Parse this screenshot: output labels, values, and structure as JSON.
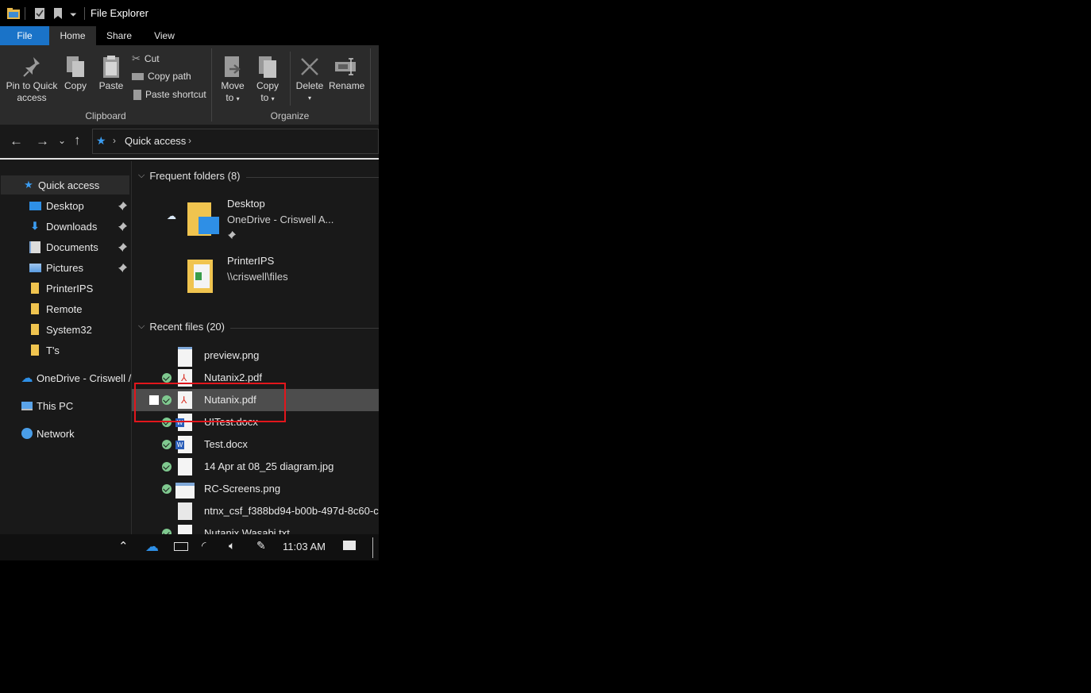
{
  "window": {
    "title": "File Explorer"
  },
  "tabs": {
    "file": "File",
    "home": "Home",
    "share": "Share",
    "view": "View"
  },
  "ribbon": {
    "pin_quick_access": [
      "Pin to Quick",
      "access"
    ],
    "copy": "Copy",
    "paste": "Paste",
    "cut": "Cut",
    "copy_path": "Copy path",
    "paste_shortcut": "Paste shortcut",
    "clipboard_group": "Clipboard",
    "move_to": [
      "Move",
      "to"
    ],
    "copy_to": [
      "Copy",
      "to"
    ],
    "delete": "Delete",
    "rename": "Rename",
    "organize_group": "Organize"
  },
  "address": {
    "crumb": "Quick access"
  },
  "sidebar": {
    "quick_access": "Quick access",
    "items": [
      {
        "label": "Desktop",
        "pinned": true
      },
      {
        "label": "Downloads",
        "pinned": true
      },
      {
        "label": "Documents",
        "pinned": true
      },
      {
        "label": "Pictures",
        "pinned": true
      },
      {
        "label": "PrinterIPS",
        "pinned": false
      },
      {
        "label": "Remote",
        "pinned": false
      },
      {
        "label": "System32",
        "pinned": false
      },
      {
        "label": "T's",
        "pinned": false
      }
    ],
    "onedrive": "OneDrive - Criswell /",
    "this_pc": "This PC",
    "network": "Network"
  },
  "content": {
    "frequent_header": "Frequent folders (8)",
    "folders": [
      {
        "name": "Desktop",
        "sub": "OneDrive - Criswell A..."
      },
      {
        "name": "PrinterIPS",
        "sub": "\\\\criswell\\files"
      }
    ],
    "recent_header": "Recent files (20)",
    "files": [
      {
        "name": "preview.png",
        "synced": false,
        "icon": "image-file-icon"
      },
      {
        "name": "Nutanix2.pdf",
        "synced": true,
        "icon": "pdf-file-icon"
      },
      {
        "name": "Nutanix.pdf",
        "synced": true,
        "icon": "pdf-file-icon",
        "selected": true
      },
      {
        "name": "UITest.docx",
        "synced": true,
        "icon": "word-file-icon"
      },
      {
        "name": "Test.docx",
        "synced": true,
        "icon": "word-file-icon"
      },
      {
        "name": "14 Apr at 08_25 diagram.jpg",
        "synced": true,
        "icon": "blank-file-icon"
      },
      {
        "name": "RC-Screens.png",
        "synced": true,
        "icon": "image-file-icon"
      },
      {
        "name": "ntnx_csf_f388bd94-b00b-497d-8c60-c",
        "synced": false,
        "icon": "text-file-icon"
      },
      {
        "name": "Nutanix Wasabi.txt",
        "synced": true,
        "icon": "blank-file-icon"
      }
    ]
  },
  "taskbar": {
    "time": "11:03 AM"
  },
  "colors": {
    "accent": "#1a73c8",
    "highlight": "#e2161c",
    "synced": "#7fc98f"
  }
}
